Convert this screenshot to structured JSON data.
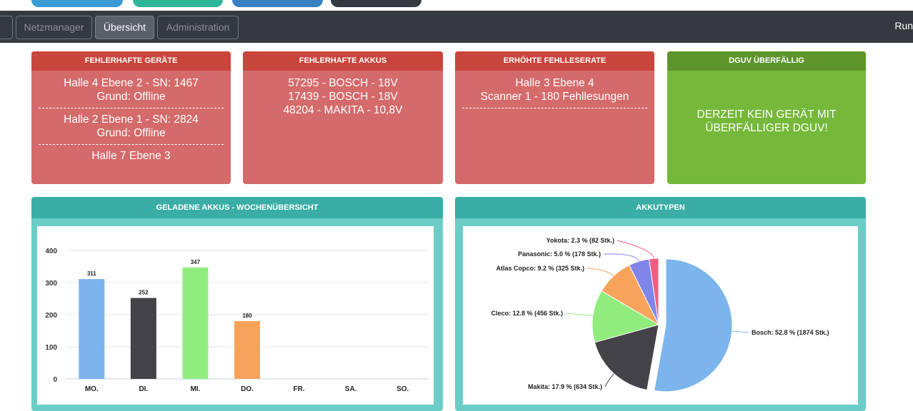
{
  "nav": {
    "items": [
      {
        "label": "Netzmanager",
        "active": false
      },
      {
        "label": "Übersicht",
        "active": true
      },
      {
        "label": "Administration",
        "active": false
      }
    ],
    "right_text": "Run"
  },
  "cards": {
    "defective_devices": {
      "title": "FEHLERHAFTE GERÄTE",
      "entries": [
        {
          "line1": "Halle 4 Ebene 2 - SN: 1467",
          "line2": "Grund: Offline"
        },
        {
          "line1": "Halle 2 Ebene 1 - SN: 2824",
          "line2": "Grund: Offline"
        },
        {
          "line1": "Halle 7 Ebene 3",
          "line2": ""
        }
      ]
    },
    "defective_batteries": {
      "title": "FEHLERHAFTE AKKUS",
      "lines": [
        "57295 - BOSCH - 18V",
        "17439 - BOSCH - 18V",
        "48204 - MAKITA - 10,8V"
      ]
    },
    "error_rate": {
      "title": "ERHÖHTE FEHLLESERATE",
      "lines": [
        "Halle 3 Ebene 4",
        "Scanner 1 - 180 Fehllesungen"
      ]
    },
    "dguv": {
      "title": "DGUV ÜBERFÄLLIG",
      "message_line1": "DERZEIT KEIN GERÄT MIT",
      "message_line2": "ÜBERFÄLLIGER DGUV!",
      "color": "#75b83a"
    }
  },
  "panels": {
    "weekly": {
      "title": "GELADENE AKKUS - WOCHENÜBERSICHT"
    },
    "types": {
      "title": "AKKUTYPEN"
    }
  },
  "chart_data": [
    {
      "type": "bar",
      "categories": [
        "MO.",
        "DI.",
        "MI.",
        "DO.",
        "FR.",
        "SA.",
        "SO."
      ],
      "values": [
        311,
        252,
        347,
        180,
        0,
        0,
        0
      ],
      "data_labels": [
        "311",
        "252",
        "347",
        "180",
        "",
        "",
        ""
      ],
      "colors": [
        "#7cb5ec",
        "#434348",
        "#90ed7d",
        "#f7a35c",
        "#8085e9",
        "#f15c80",
        "#e4d354"
      ],
      "ylim": [
        0,
        400
      ],
      "yticks": [
        0,
        100,
        200,
        300,
        400
      ],
      "grid": true,
      "legend": false
    },
    {
      "type": "pie",
      "slices": [
        {
          "name": "Bosch",
          "percent": 52.8,
          "count": 1874,
          "label": "Bosch: 52.8 % (1874 Stk.)",
          "color": "#7cb5ec",
          "sliced": true
        },
        {
          "name": "Makita",
          "percent": 17.9,
          "count": 634,
          "label": "Makita: 17.9 % (634 Stk.)",
          "color": "#434348"
        },
        {
          "name": "Cleco",
          "percent": 12.8,
          "count": 456,
          "label": "Cleco: 12.8 % (456 Stk.)",
          "color": "#90ed7d"
        },
        {
          "name": "Atlas Copco",
          "percent": 9.2,
          "count": 325,
          "label": "Atlas Copco: 9.2 % (325 Stk.)",
          "color": "#f7a35c"
        },
        {
          "name": "Panasonic",
          "percent": 5.0,
          "count": 178,
          "label": "Panasonic: 5.0 % (178 Stk.)",
          "color": "#8085e9"
        },
        {
          "name": "Yokota",
          "percent": 2.3,
          "count": 82,
          "label": "Yokota: 2.3 % (82 Stk.)",
          "color": "#f15c80"
        }
      ],
      "legend": false
    }
  ]
}
